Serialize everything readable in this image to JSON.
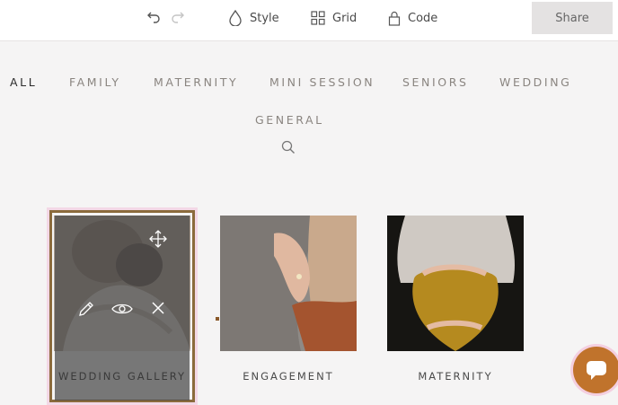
{
  "toolbar": {
    "style_label": "Style",
    "grid_label": "Grid",
    "code_label": "Code",
    "share_label": "Share"
  },
  "filters": [
    "ALL",
    "FAMILY",
    "MATERNITY",
    "MINI SESSION",
    "SENIORS",
    "WEDDING",
    "GENERAL"
  ],
  "active_filter": "ALL",
  "galleries": [
    {
      "title": "WEDDING GALLERY",
      "selected": true
    },
    {
      "title": "ENGAGEMENT",
      "selected": false
    },
    {
      "title": "MATERNITY",
      "selected": false
    }
  ],
  "colors": {
    "accent": "#c0732c",
    "selection_border": "#8b6b3c",
    "background": "#f5f4f4"
  },
  "icons": [
    "undo-icon",
    "redo-icon",
    "drop-icon",
    "grid-icon",
    "lock-icon",
    "search-icon",
    "move-icon",
    "pencil-icon",
    "eye-icon",
    "close-icon",
    "chat-icon"
  ]
}
